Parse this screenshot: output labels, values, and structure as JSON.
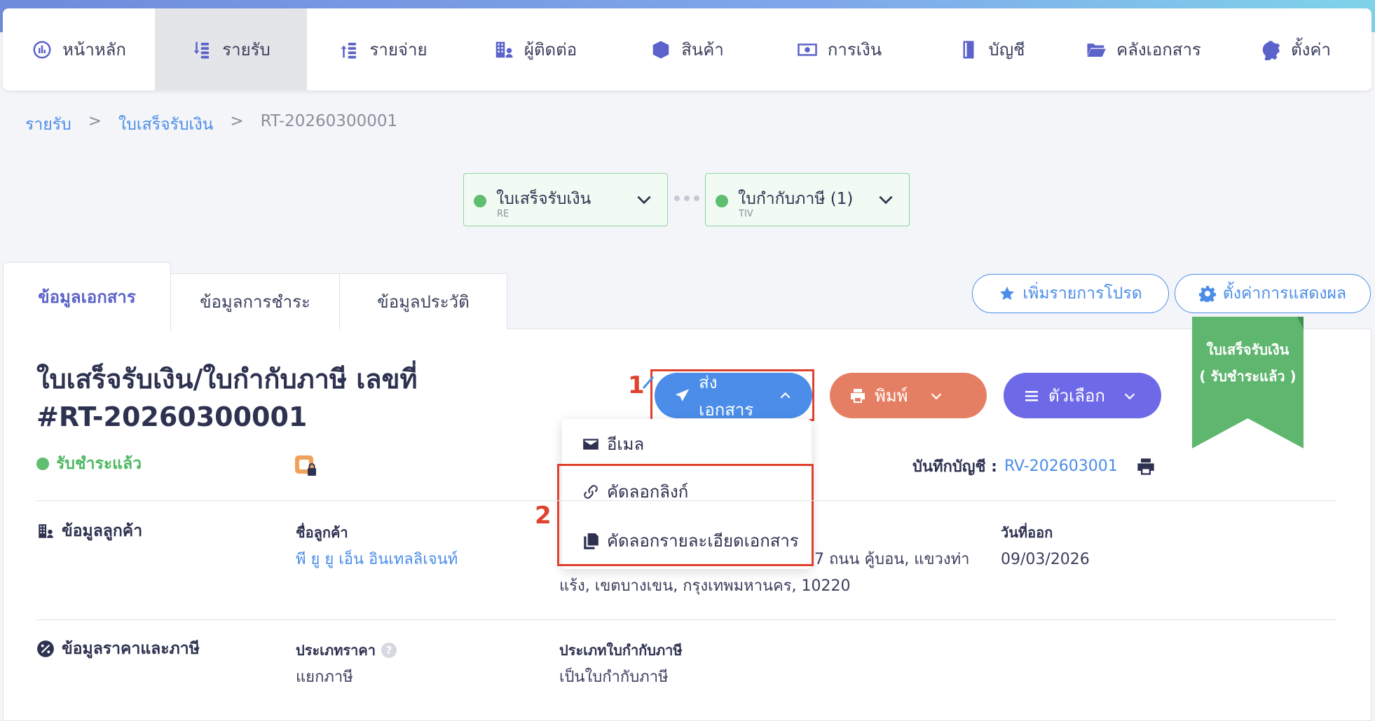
{
  "nav": {
    "items": [
      {
        "label": "หน้าหลัก",
        "icon": "dashboard-icon"
      },
      {
        "label": "รายรับ",
        "icon": "income-icon"
      },
      {
        "label": "รายจ่าย",
        "icon": "expense-icon"
      },
      {
        "label": "ผู้ติดต่อ",
        "icon": "contacts-icon"
      },
      {
        "label": "สินค้า",
        "icon": "product-box-icon"
      },
      {
        "label": "การเงิน",
        "icon": "money-icon"
      },
      {
        "label": "บัญชี",
        "icon": "ledger-icon"
      },
      {
        "label": "คลังเอกสาร",
        "icon": "folder-icon"
      },
      {
        "label": "ตั้งค่า",
        "icon": "gear-icon"
      }
    ],
    "active_index": 1
  },
  "breadcrumb": {
    "level1": "รายรับ",
    "sep": ">",
    "level2": "ใบเสร็จรับเงิน",
    "current": "RT-20260300001"
  },
  "flow": [
    {
      "title": "ใบเสร็จรับเงิน",
      "code": "RE"
    },
    {
      "title": "ใบกำกับภาษี (1)",
      "code": "TIV"
    }
  ],
  "tabs": [
    "ข้อมูลเอกสาร",
    "ข้อมูลการชำระ",
    "ข้อมูลประวัติ"
  ],
  "top_actions": {
    "favorite": "เพิ่มรายการโปรด",
    "display_settings": "ตั้งค่าการแสดงผล"
  },
  "document": {
    "title": "ใบเสร็จรับเงิน/ใบกำกับภาษี เลขที่ #RT-20260300001",
    "status": "รับชำระแล้ว",
    "ribbon_line1": "ใบเสร็จรับเงิน",
    "ribbon_line2": "( รับชำระแล้ว )",
    "account_label": "บันทึกบัญชี :",
    "account_value": "RV-202603001"
  },
  "actions": {
    "send": "ส่งเอกสาร",
    "print": "พิมพ์",
    "options": "ตัวเลือก"
  },
  "send_menu": {
    "email": "อีเมล",
    "copy_link": "คัดลอกลิงก์",
    "copy_details": "คัดลอกรายละเอียดเอกสาร"
  },
  "annotations": {
    "one": "1",
    "two": "2"
  },
  "customer": {
    "section": "ข้อมูลลูกค้า",
    "name_label": "ชื่อลูกค้า",
    "name_value": "พี ยู ยู เอ็น อินเทลลิเจนท์",
    "address_line1": "7 ถนน คู้บอน, แขวงท่า",
    "address_line2": "แร้ง, เขตบางเขน, กรุงเทพมหานคร, 10220",
    "date_label": "วันที่ออก",
    "date_value": "09/03/2026"
  },
  "pricing": {
    "section": "ข้อมูลราคาและภาษี",
    "price_type_label": "ประเภทราคา",
    "price_type_value": "แยกภาษี",
    "tax_type_label": "ประเภทใบกำกับภาษี",
    "tax_type_value": "เป็นใบกำกับภาษี"
  },
  "colors": {
    "send": "#4b8de8",
    "print": "#e57f63",
    "options": "#6e69e6",
    "status_green": "#5fbe6f",
    "highlight_red": "#e0412e"
  }
}
